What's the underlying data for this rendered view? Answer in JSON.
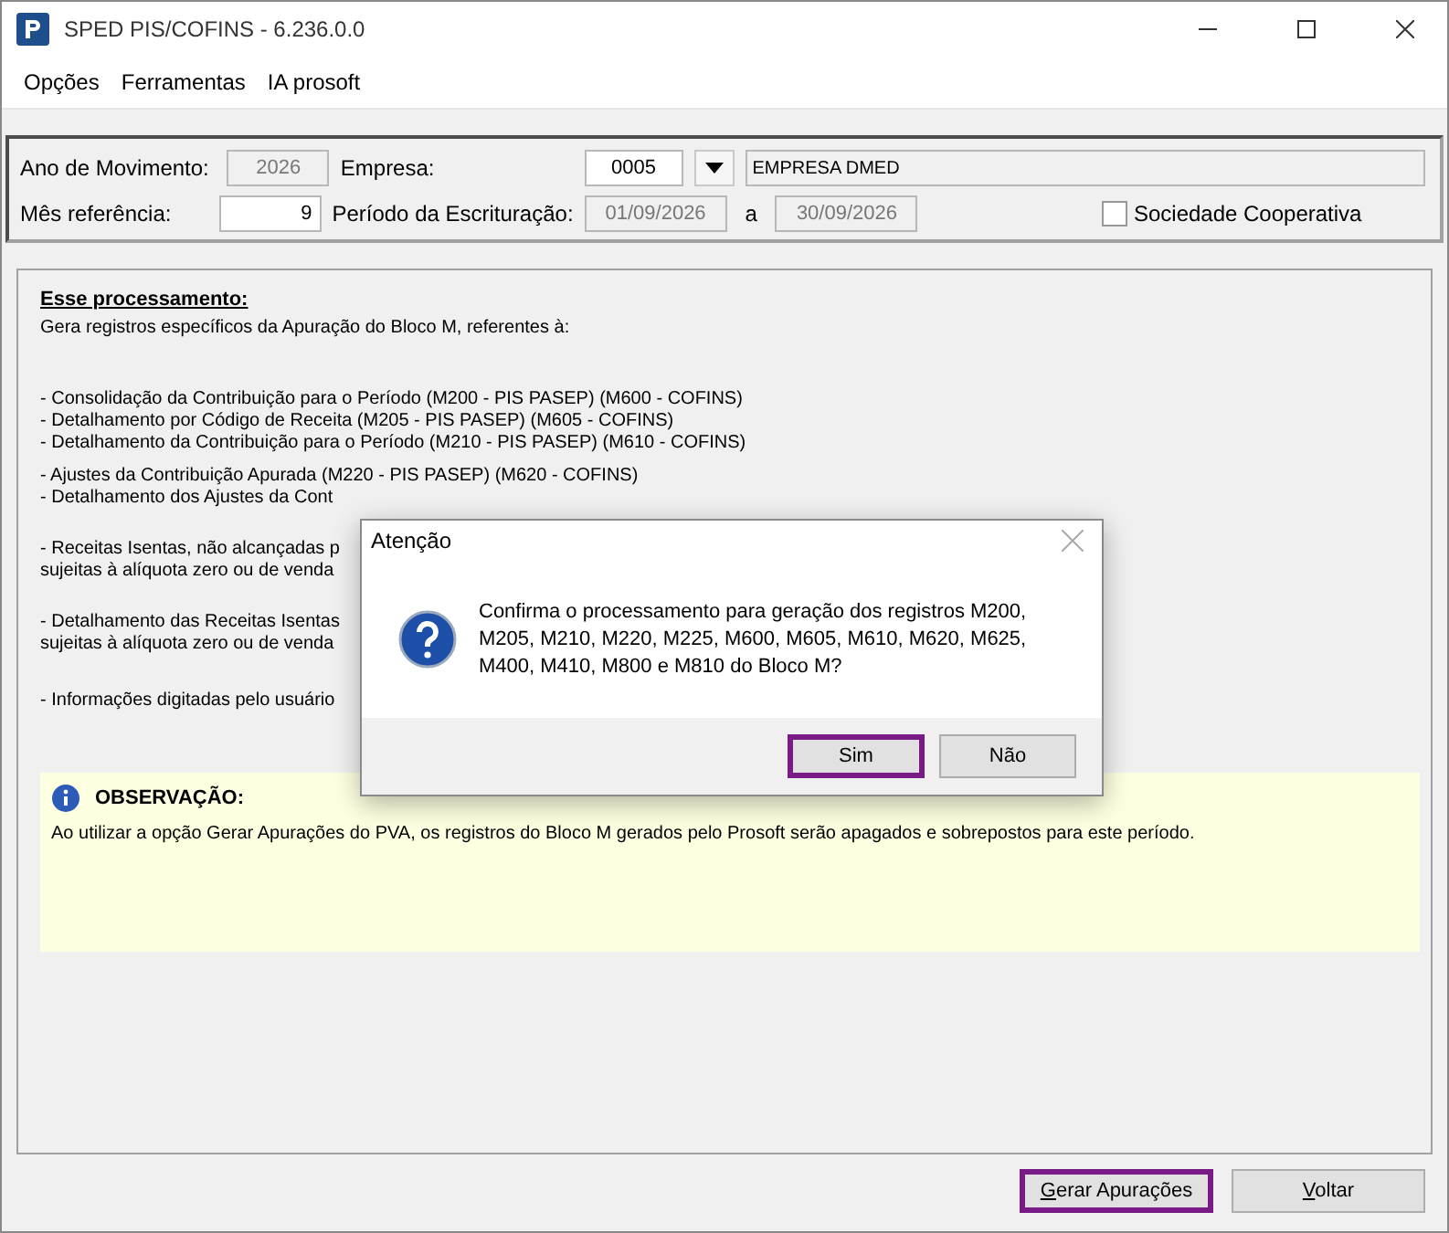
{
  "window": {
    "title": "SPED PIS/COFINS - 6.236.0.0"
  },
  "menu": [
    "Opções",
    "Ferramentas",
    "IA prosoft"
  ],
  "form": {
    "ano_label": "Ano de Movimento:",
    "ano": "2026",
    "empresa_label": "Empresa:",
    "empresa_code": "0005",
    "empresa_name": "EMPRESA DMED",
    "mes_label": "Mês referência:",
    "mes": "9",
    "periodo_label": "Período da Escrituração:",
    "periodo_inicio": "01/09/2026",
    "periodo_sep": "a",
    "periodo_fim": "30/09/2026",
    "cooperativa": {
      "label": "Sociedade Cooperativa",
      "checked": false
    }
  },
  "content": {
    "heading": "Esse processamento:",
    "intro": "Gera registros específicos da Apuração do Bloco M, referentes à:",
    "groups": [
      [
        "- Consolidação da Contribuição para o Período (M200 - PIS PASEP) (M600 - COFINS)",
        "- Detalhamento por Código de Receita (M205 - PIS PASEP) (M605 - COFINS)",
        "- Detalhamento da Contribuição para o Período (M210 - PIS PASEP) (M610 - COFINS)"
      ],
      [
        "- Ajustes da Contribuição Apurada (M220 - PIS PASEP) (M620 - COFINS)",
        "- Detalhamento dos Ajustes da Cont"
      ],
      [
        "- Receitas Isentas, não alcançadas p",
        "sujeitas à alíquota zero ou de venda"
      ],
      [
        "- Detalhamento das Receitas Isentas",
        "sujeitas à alíquota zero ou de venda"
      ],
      [
        "- Informações digitadas pelo usuário"
      ]
    ],
    "note": {
      "title": "OBSERVAÇÃO:",
      "text": "Ao utilizar a opção Gerar Apurações do PVA, os registros do Bloco M gerados pelo Prosoft serão apagados e sobrepostos para este período."
    }
  },
  "buttons": [
    {
      "label": "Gerar Apurações",
      "highlighted": true
    },
    {
      "label": "Voltar",
      "highlighted": false
    }
  ],
  "dialog": {
    "title": "Atenção",
    "message": "Confirma o processamento para geração dos registros M200, M205, M210, M220, M225, M600, M605, M610, M620, M625, M400, M410, M800 e M810 do Bloco M?",
    "buttons": [
      {
        "label": "Sim",
        "highlighted": true
      },
      {
        "label": "Não",
        "highlighted": false
      }
    ]
  }
}
